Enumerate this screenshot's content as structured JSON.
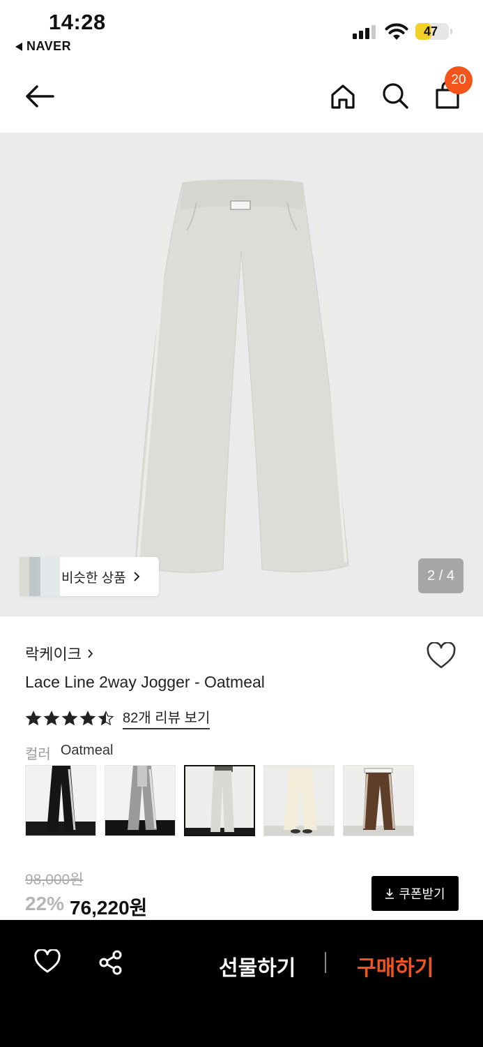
{
  "status_bar": {
    "time": "14:28",
    "back_app": "NAVER",
    "battery": "47",
    "battery_level_percent": 47
  },
  "nav": {
    "cart_count": "20"
  },
  "gallery": {
    "similar_label": "비슷한 상품",
    "pager": "2 / 4"
  },
  "product": {
    "brand": "락케이크",
    "title": "Lace Line 2way Jogger - Oatmeal",
    "rating_stars": 4.5,
    "review_link": "82개 리뷰 보기",
    "color_label": "컬러",
    "color_value": "Oatmeal",
    "swatches": [
      "black",
      "gray",
      "oatmeal",
      "cream",
      "brown"
    ],
    "selected_swatch": "oatmeal",
    "original_price": "98,000원",
    "discount": "22%",
    "sale_price": "76,220원",
    "coupon_label": "쿠폰받기"
  },
  "bottom_bar": {
    "gift_label": "선물하기",
    "buy_label": "구매하기"
  },
  "colors": {
    "accent": "#f2541b",
    "badge": "#f2541b",
    "battery": "#f3d02a"
  },
  "icons": {
    "back": "arrow-left-icon",
    "home": "home-icon",
    "search": "search-icon",
    "cart": "shopping-bag-icon",
    "wishlist": "heart-icon",
    "share": "share-icon",
    "download": "download-icon"
  }
}
